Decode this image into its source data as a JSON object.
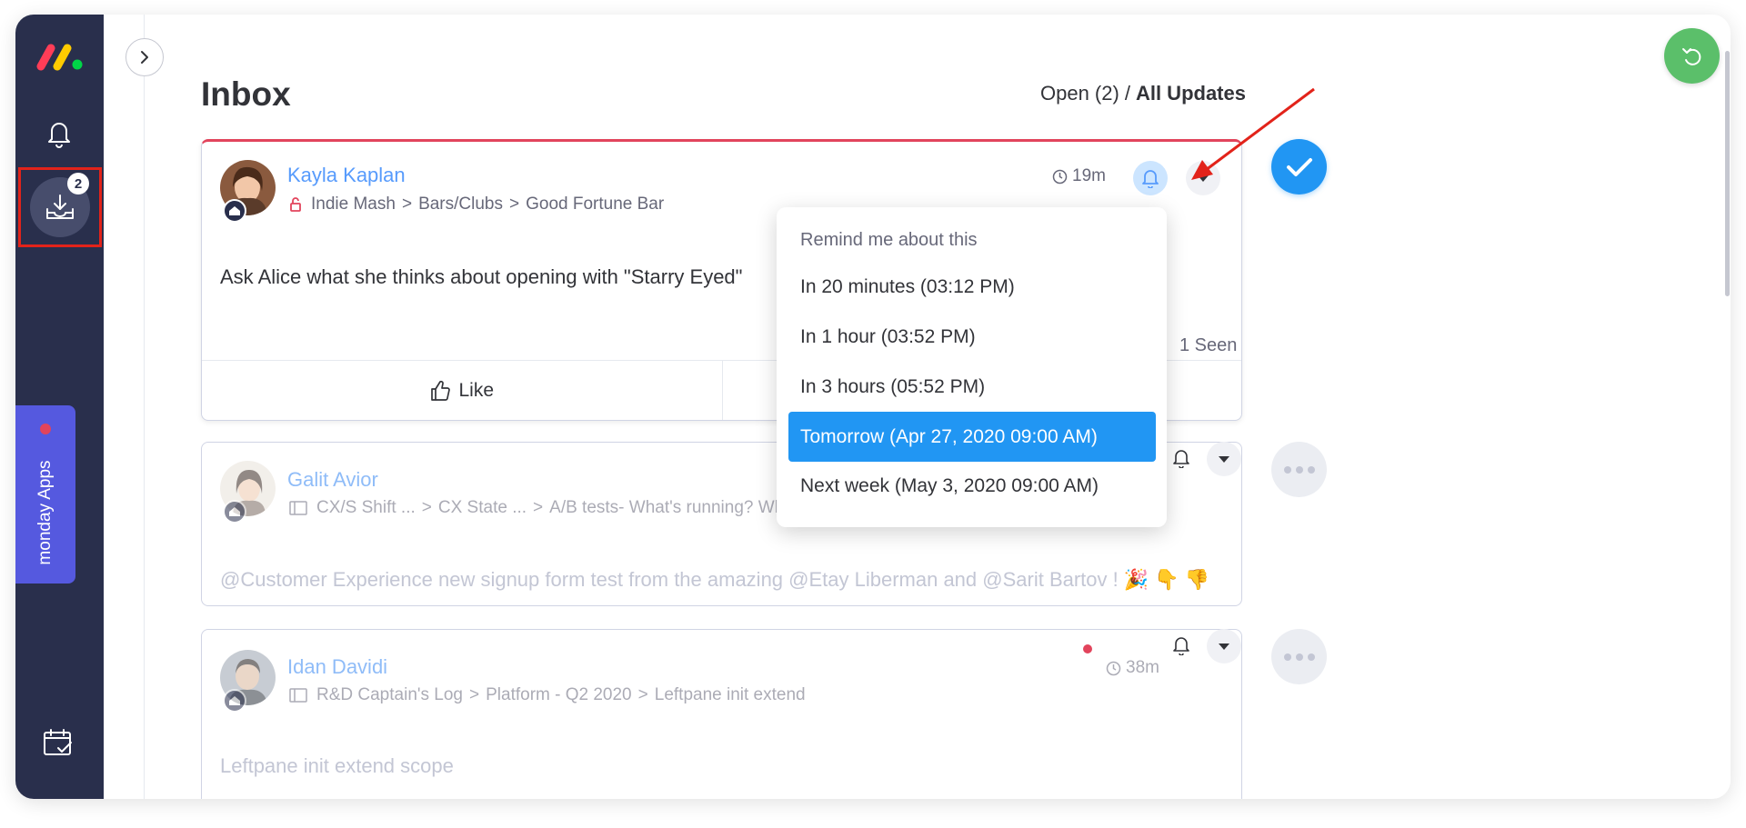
{
  "sidebar": {
    "logo": "monday-logo",
    "inbox_badge": "2",
    "apps_label": "monday Apps",
    "icons": [
      "bell-icon",
      "inbox-icon",
      "calendar-check-icon"
    ]
  },
  "header": {
    "title": "Inbox",
    "filter_open": "Open (2)",
    "filter_separator": "/",
    "filter_all": "All Updates"
  },
  "updates": [
    {
      "author": "Kayla Kaplan",
      "crumbs": [
        "Indie Mash",
        "Bars/Clubs",
        "Good Fortune Bar"
      ],
      "body": "Ask Alice what she thinks about opening with \"Starry Eyed\"",
      "time": "19m",
      "seen": "1 Seen",
      "like_label": "Like"
    },
    {
      "author": "Galit Avior",
      "crumbs": [
        "CX/S Shift ...",
        "CX State ...",
        "A/B tests- What's running? What's frozen or closed..."
      ],
      "body": "@Customer Experience  new signup form test from the amazing @Etay Liberman and @Sarit Bartov ! 🎉 👇 👎"
    },
    {
      "author": "Idan Davidi",
      "crumbs": [
        "R&D Captain's Log",
        "Platform - Q2 2020",
        "Leftpane init extend"
      ],
      "body": "Leftpane init extend scope",
      "time": "38m"
    }
  ],
  "reminder_menu": {
    "title": "Remind me about this",
    "options": [
      "In 20 minutes (03:12 PM)",
      "In 1 hour (03:52 PM)",
      "In 3 hours (05:52 PM)",
      "Tomorrow (Apr 27, 2020 09:00 AM)",
      "Next week (May 3, 2020 09:00 AM)"
    ],
    "selected_index": 3
  },
  "colors": {
    "sidebar": "#292f4c",
    "accent_blue": "#2196f3",
    "link_blue": "#579bfc",
    "apps_purple": "#5559df",
    "undo_green": "#5bbf6a",
    "unread_red": "#e2445c",
    "annotation_red": "#e2231a"
  }
}
